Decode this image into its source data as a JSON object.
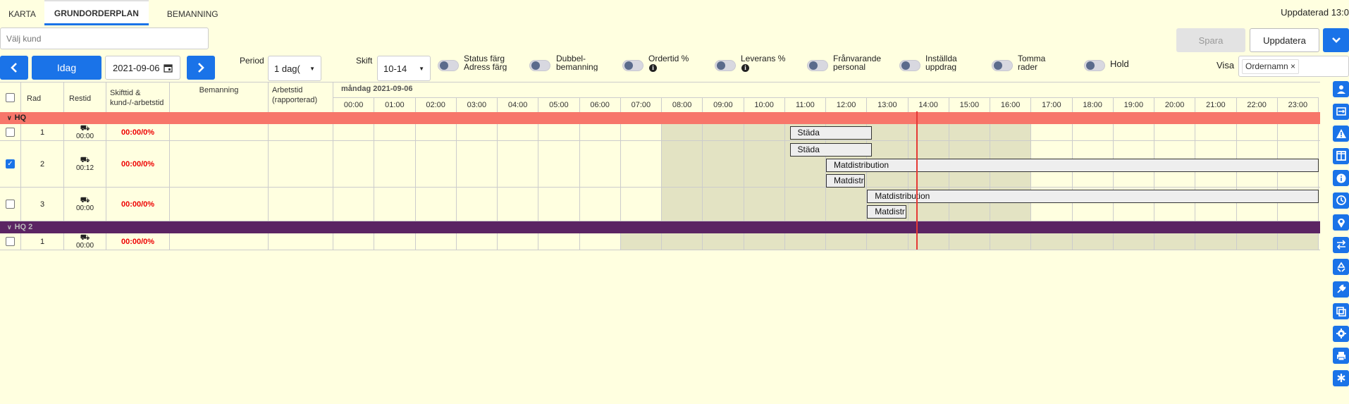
{
  "tabs": [
    {
      "label": "KARTA",
      "active": false
    },
    {
      "label": "GRUNDORDERPLAN",
      "active": true
    },
    {
      "label": "BEMANNING",
      "active": false
    }
  ],
  "updated_label": "Uppdaterad 13:0",
  "customer": {
    "placeholder": "Välj kund"
  },
  "buttons": {
    "save": "Spara",
    "update": "Uppdatera",
    "today": "Idag"
  },
  "date": "2021-09-06",
  "period": {
    "label": "Period",
    "value": "1 dag("
  },
  "shift": {
    "label": "Skift",
    "value": "10-14"
  },
  "toggles": [
    {
      "label": "Status färg Adress färg",
      "info": false
    },
    {
      "label": "Dubbel- bemanning",
      "info": false
    },
    {
      "label": "Ordertid %",
      "info": true
    },
    {
      "label": "Leverans %",
      "info": true
    },
    {
      "label": "Frånvarande personal",
      "info": false
    },
    {
      "label": "Inställda uppdrag",
      "info": false
    },
    {
      "label": "Tomma rader",
      "info": false
    },
    {
      "label": "Hold",
      "info": false
    }
  ],
  "visa": {
    "label": "Visa",
    "chip": "Ordernamn",
    "chip_remove": "×"
  },
  "table": {
    "headers": {
      "rad": "Rad",
      "restid": "Restid",
      "skifttid": "Skifttid & kund-/-arbetstid",
      "bemanning": "Bemanning",
      "arbetstid": "Arbetstid (rapporterad)"
    },
    "day_label": "måndag 2021-09-06",
    "hours": [
      "00:00",
      "01:00",
      "02:00",
      "03:00",
      "04:00",
      "05:00",
      "06:00",
      "07:00",
      "08:00",
      "09:00",
      "10:00",
      "11:00",
      "12:00",
      "13:00",
      "14:00",
      "15:00",
      "16:00",
      "17:00",
      "18:00",
      "19:00",
      "20:00",
      "21:00",
      "22:00",
      "23:00"
    ],
    "groups": [
      {
        "name": "HQ",
        "color": "#f7766a",
        "rows": [
          {
            "rad": "1",
            "restid": "00:00",
            "skifttid": "00:00/0%",
            "checked": false,
            "tasks": [
              {
                "name": "Städa",
                "start": "11:07",
                "end": "13:07"
              }
            ]
          },
          {
            "rad": "2",
            "restid": "00:12",
            "skifttid": "00:00/0%",
            "checked": true,
            "tasks": [
              {
                "name": "Städa",
                "start": "11:07",
                "end": "13:07"
              },
              {
                "name": "Matdistribution",
                "start": "12:00",
                "end": "24:00"
              },
              {
                "name": "Matdistr",
                "start": "12:00",
                "end": "12:57"
              }
            ]
          },
          {
            "rad": "3",
            "restid": "00:00",
            "skifttid": "00:00/0%",
            "checked": false,
            "tasks": [
              {
                "name": "Matdistribution",
                "start": "13:00",
                "end": "24:00"
              },
              {
                "name": "Matdistr",
                "start": "13:00",
                "end": "13:57"
              }
            ]
          }
        ]
      },
      {
        "name": "HQ 2",
        "color": "#5b2463",
        "rows": [
          {
            "rad": "1",
            "restid": "00:00",
            "skifttid": "00:00/0%",
            "checked": false,
            "tasks": []
          }
        ]
      }
    ]
  },
  "current_time": "14:12",
  "side_icons": [
    "user-icon",
    "swap-calendar-icon",
    "warning-icon",
    "columns-icon",
    "info-icon",
    "history-icon",
    "map-pin-icon",
    "arrows-exchange-icon",
    "recycle-icon",
    "plug-icon",
    "copy-icon",
    "settings-icon",
    "print-icon",
    "asterisk-icon"
  ],
  "colors": {
    "accent": "#1a73e8",
    "background": "#ffffe0",
    "hq": "#f7766a",
    "hq2": "#5b2463",
    "now_line": "#e53935"
  }
}
